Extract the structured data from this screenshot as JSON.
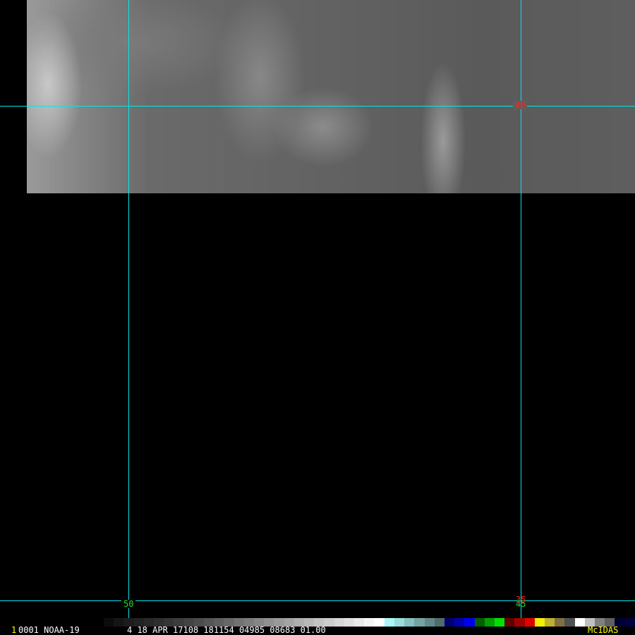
{
  "grid_labels": {
    "top_lat": "40",
    "bottom_lat": "35",
    "bottom_lat_overlap": "45",
    "bottom_lon": "50"
  },
  "status": {
    "frame": "1",
    "image_info": "0001 NOAA-19",
    "details": "4 18 APR 17108 181154 04985 08683 01.00",
    "brand": "McIDAS"
  },
  "colors": {
    "grid": "#00e5e5",
    "label_red": "#ff2020",
    "label_green": "#20e020",
    "brand": "#ffff00"
  },
  "colorbar": [
    "#0c0c0c",
    "#151515",
    "#1c1c1c",
    "#222",
    "#282828",
    "#2e2e2e",
    "#353535",
    "#3c3c3c",
    "#444",
    "#4c4c4c",
    "#555",
    "#5e5e5e",
    "#686868",
    "#727272",
    "#7c7c7c",
    "#868686",
    "#909090",
    "#9a9a9a",
    "#a4a4a4",
    "#aeaeae",
    "#b8b8b8",
    "#c2c2c2",
    "#cccccc",
    "#d6d6d6",
    "#e0e0e0",
    "#eaeaea",
    "#f5f5f5",
    "#ffffff",
    "#aaf5f5",
    "#98dcdc",
    "#86c0c0",
    "#74a4a4",
    "#628888",
    "#506c6c",
    "#000070",
    "#0000b0",
    "#0000f0",
    "#006000",
    "#00a000",
    "#00e000",
    "#600000",
    "#a00000",
    "#e00000",
    "#f0f000",
    "#c0b030",
    "#807040",
    "#505050",
    "#ffffff",
    "#c0c0c0",
    "#808080",
    "#606060",
    "#000030",
    "#000040"
  ]
}
